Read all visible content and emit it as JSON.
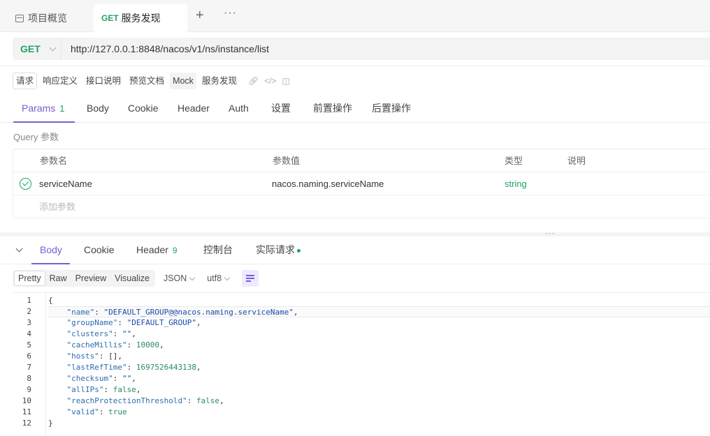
{
  "tabs": [
    {
      "label": "项目概览",
      "icon": "panel-icon"
    },
    {
      "method": "GET",
      "label": "服务发现",
      "active": true
    }
  ],
  "tab_add": "+",
  "tab_more": "···",
  "request": {
    "method": "GET",
    "url": "http://127.0.0.1:8848/nacos/v1/ns/instance/list"
  },
  "subbar": [
    "请求",
    "响应定义",
    "接口说明",
    "预览文档",
    "Mock",
    "服务发现"
  ],
  "request_tabs": [
    {
      "label": "Params",
      "badge": "1",
      "active": true
    },
    {
      "label": "Body"
    },
    {
      "label": "Cookie"
    },
    {
      "label": "Header"
    },
    {
      "label": "Auth"
    },
    {
      "label": "设置"
    },
    {
      "label": "前置操作"
    },
    {
      "label": "后置操作"
    }
  ],
  "query_label": "Query 参数",
  "params_table": {
    "headers": [
      "参数名",
      "参数值",
      "类型",
      "说明"
    ],
    "rows": [
      {
        "enabled": true,
        "name": "serviceName",
        "value": "nacos.naming.serviceName",
        "type": "string",
        "desc": ""
      }
    ],
    "add_placeholder": "添加参数"
  },
  "response_tabs": [
    {
      "label": "Body",
      "active": true
    },
    {
      "label": "Cookie"
    },
    {
      "label": "Header",
      "badge": "9"
    },
    {
      "label": "控制台"
    },
    {
      "label": "实际请求",
      "dot": true
    }
  ],
  "format_tabs": [
    "Pretty",
    "Raw",
    "Preview",
    "Visualize"
  ],
  "format_active": "Pretty",
  "format_type": "JSON",
  "encoding": "utf8",
  "colors": {
    "accent": "#7a5dd6",
    "get": "#21a366"
  },
  "code_lines": [
    "{",
    "    \"name\": \"DEFAULT_GROUP@@nacos.naming.serviceName\",",
    "    \"groupName\": \"DEFAULT_GROUP\",",
    "    \"clusters\": \"\",",
    "    \"cacheMillis\": 10000,",
    "    \"hosts\": [],",
    "    \"lastRefTime\": 1697526443138,",
    "    \"checksum\": \"\",",
    "    \"allIPs\": false,",
    "    \"reachProtectionThreshold\": false,",
    "    \"valid\": true",
    "}"
  ]
}
